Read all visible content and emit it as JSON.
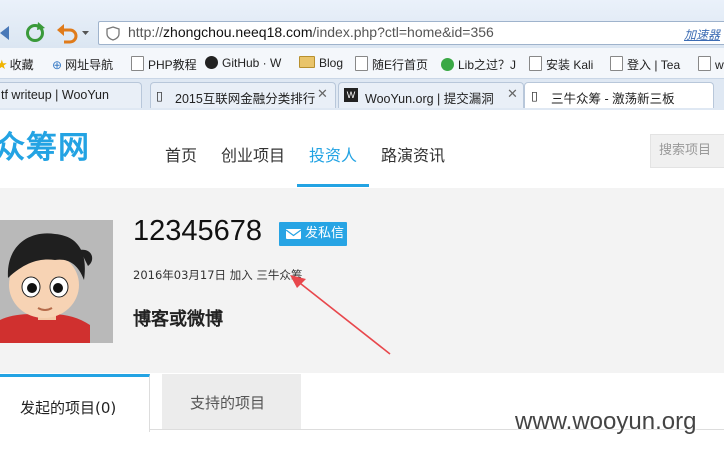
{
  "browser": {
    "url_prefix": "http://",
    "url_domain": "zhongchou.neeq18.com",
    "url_rest": "/index.php?ctl=home&id=356",
    "accelerator_label": "加速器",
    "bookmarks": [
      {
        "label": "收藏",
        "icon": "star-icon"
      },
      {
        "label": "网址导航",
        "icon": "globe-icon"
      },
      {
        "label": "PHP教程",
        "icon": "page-icon"
      },
      {
        "label": "GitHub · W",
        "icon": "github-icon"
      },
      {
        "label": "Blog",
        "icon": "folder-icon"
      },
      {
        "label": "随E行首页",
        "icon": "page-icon"
      },
      {
        "label": "Lib之过？J",
        "icon": "lib-icon"
      },
      {
        "label": "安装 Kali",
        "icon": "page-icon"
      },
      {
        "label": "登入 | Tea",
        "icon": "page-icon"
      },
      {
        "label": "ww",
        "icon": "page-icon"
      }
    ],
    "tabs": [
      {
        "label": "tf writeup | WooYun"
      },
      {
        "label": "2015互联网金融分类排行"
      },
      {
        "label": "WooYun.org | 提交漏洞"
      },
      {
        "label": "三牛众筹 - 激荡新三板"
      }
    ]
  },
  "site": {
    "logo": "众筹网",
    "nav": [
      "首页",
      "创业项目",
      "投资人",
      "路演资讯"
    ],
    "active_nav": "投资人",
    "search_label": "搜索项目"
  },
  "profile": {
    "username": "12345678",
    "message_button": "发私信",
    "join_date": "2016年03月17日",
    "join_text": "加入",
    "join_site": "三牛众筹",
    "blog_label": "博客或微博"
  },
  "profile_tabs": {
    "initiated": "发起的项目(0)",
    "supported": "支持的项目"
  },
  "watermark": "www.wooyun.org",
  "colors": {
    "accent": "#23a3e3",
    "arrow": "#e8474c"
  }
}
